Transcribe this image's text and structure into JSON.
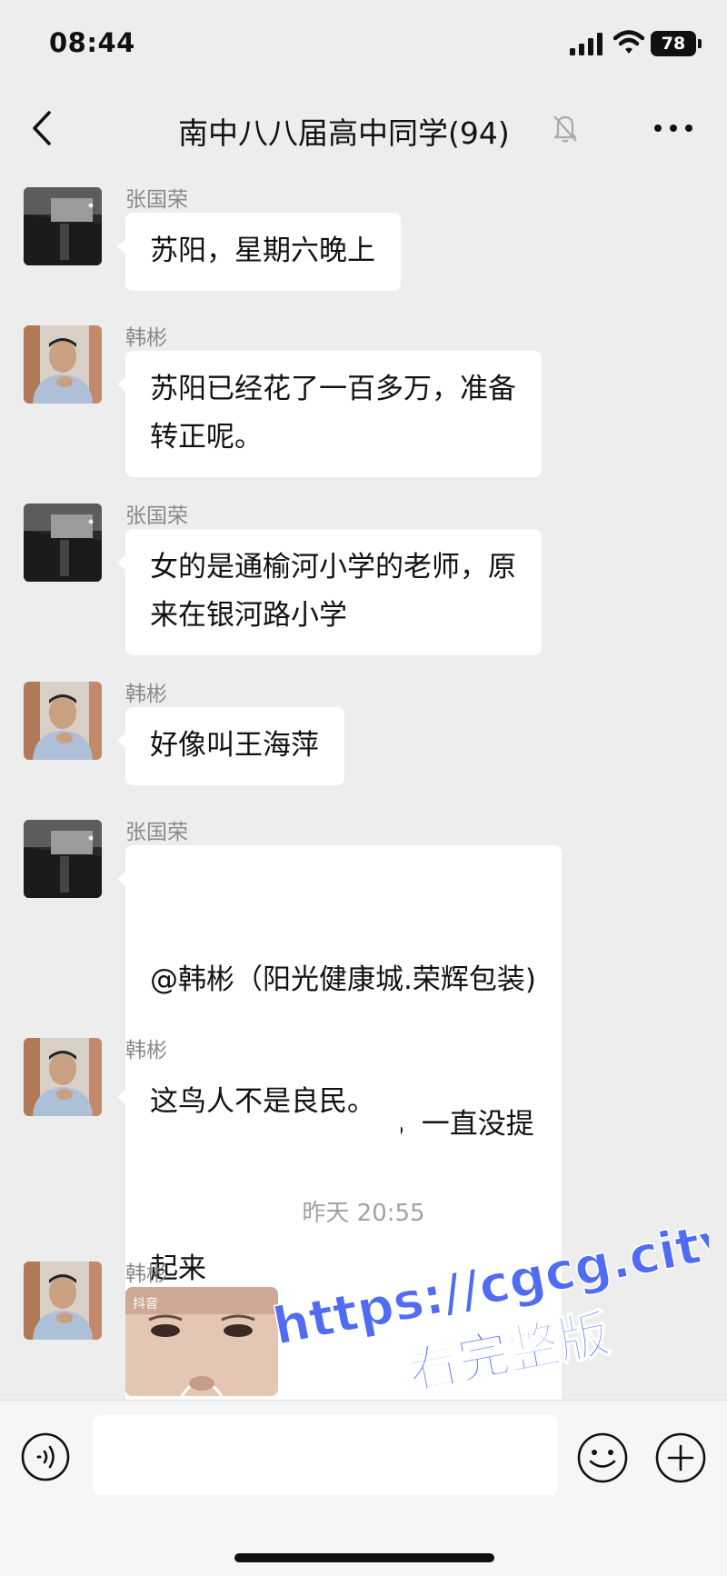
{
  "status": {
    "time": "08:44",
    "battery": "78"
  },
  "header": {
    "title": "南中八八届高中同学(94)"
  },
  "messages": [
    {
      "sender": "张国荣",
      "lines": [
        "苏阳，星期六晚上"
      ]
    },
    {
      "sender": "韩彬",
      "lines": [
        "苏阳已经花了一百多万，准备",
        "转正呢。"
      ]
    },
    {
      "sender": "张国荣",
      "lines": [
        "女的是通榆河小学的老师，原",
        "来在银河路小学"
      ]
    },
    {
      "sender": "韩彬",
      "lines": [
        "好像叫王海萍"
      ]
    },
    {
      "sender": "张国荣",
      "lines": [
        "@韩彬（阳光健康城.荣辉包装)",
        "  据传老有人民来信，一直没提",
        "起来"
      ]
    },
    {
      "sender": "韩彬",
      "lines": [
        "这鸟人不是良民。"
      ]
    }
  ],
  "timestamp": "昨天 20:55",
  "last_message": {
    "sender": "韩彬",
    "thumb_label": "抖音"
  },
  "watermark": {
    "url": "https://cgcg.city",
    "text": "看完整版"
  },
  "input": {
    "value": ""
  }
}
